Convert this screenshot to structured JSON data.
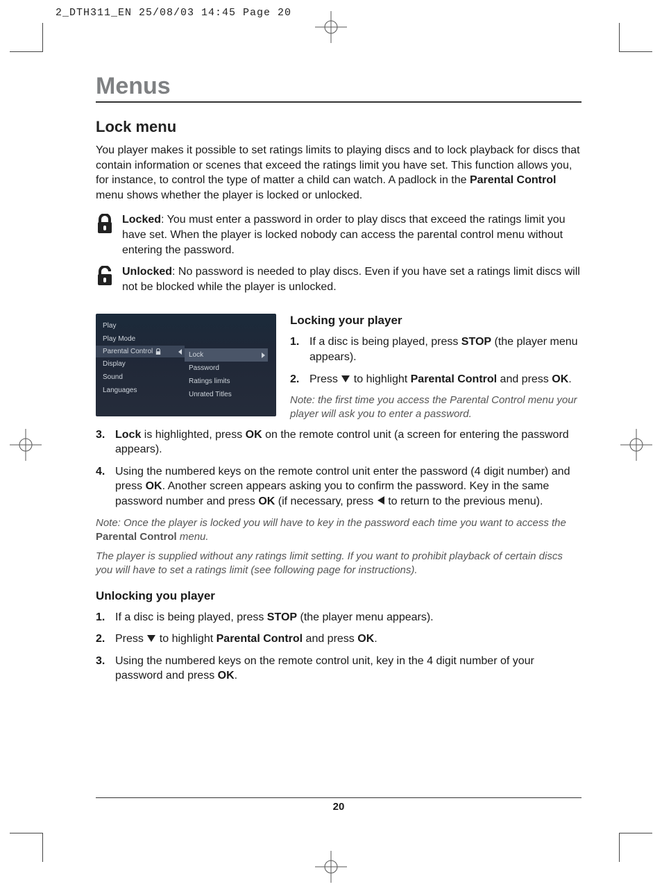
{
  "header": "2_DTH311_EN  25/08/03  14:45  Page 20",
  "main_title": "Menus",
  "section_title": "Lock menu",
  "intro_a": "You player makes it possible to set ratings limits to playing discs and to lock playback for discs that contain information or scenes that exceed the ratings limit you have set. This function allows you, for instance, to control the type of matter a child can watch. A padlock in the ",
  "intro_b_bold": "Parental Control",
  "intro_c": " menu shows whether the player is locked or unlocked.",
  "locked_label": "Locked",
  "locked_text": ": You must enter a password in order to play discs that exceed the ratings limit you have set. When the player is locked nobody can access the parental control menu without entering the password.",
  "unlocked_label": "Unlocked",
  "unlocked_text": ": No password is needed to play discs. Even if you have set a ratings limit discs will not be blocked while the player is unlocked.",
  "screenshot": {
    "left": [
      "Play",
      "Play Mode",
      "Parental Control",
      "Display",
      "Sound",
      "Languages"
    ],
    "right": [
      "Lock",
      "Password",
      "Ratings limits",
      "Unrated Titles"
    ]
  },
  "locking_title": "Locking your player",
  "lock_steps": {
    "s1_a": "If a disc is being played, press ",
    "s1_bold": "STOP",
    "s1_b": " (the player menu appears).",
    "s2_a": "Press  ",
    "s2_b": "  to highlight ",
    "s2_bold1": "Parental Control",
    "s2_c": " and press ",
    "s2_bold2": "OK",
    "s2_d": ".",
    "note2": "Note: the first time you access the Parental Control menu your player will ask you to enter a password.",
    "s3_bold1": "Lock",
    "s3_a": " is highlighted, press ",
    "s3_bold2": "OK",
    "s3_b": " on the remote control unit (a screen for entering the password appears).",
    "s4_a": "Using the numbered keys on the remote control unit enter the password (4 digit number) and press ",
    "s4_bold1": "OK",
    "s4_b": ". Another screen appears asking you to confirm the password. Key in the same password number and press ",
    "s4_bold2": "OK",
    "s4_c": " (if necessary, press  ",
    "s4_d": "  to return to the previous menu)."
  },
  "note_after_a": "Note: Once the player is locked you will have to key in the password each time you want to access the ",
  "note_after_bold": "Parental Control",
  "note_after_b": " menu.",
  "note_supply": "The player is supplied without any ratings limit setting. If you want to prohibit playback of certain discs you will have to set a ratings limit (see following page for instructions).",
  "unlocking_title": "Unlocking you player",
  "unlock_steps": {
    "s1_a": "If a disc is being played, press ",
    "s1_bold": "STOP",
    "s1_b": " (the player menu appears).",
    "s2_a": "Press  ",
    "s2_b": "  to highlight ",
    "s2_bold1": "Parental Control",
    "s2_c": " and press ",
    "s2_bold2": "OK",
    "s2_d": ".",
    "s3_a": "Using the numbered keys on the remote control unit, key in the 4 digit number of your password and press ",
    "s3_bold": "OK",
    "s3_b": "."
  },
  "page_number": "20"
}
